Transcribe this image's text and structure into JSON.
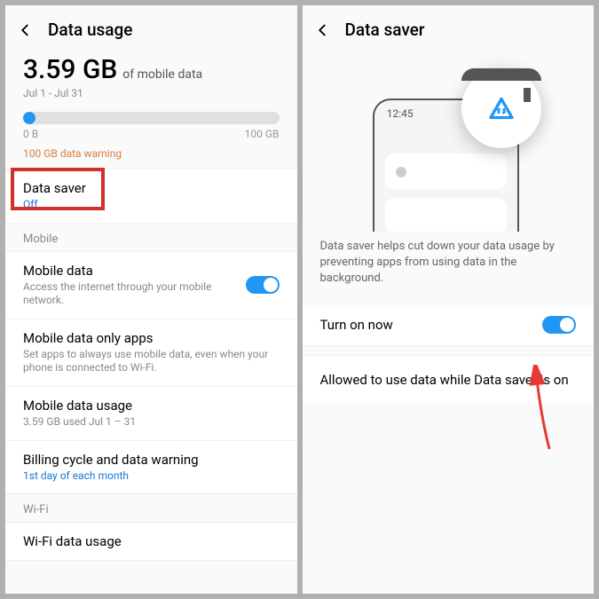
{
  "left": {
    "title": "Data usage",
    "amount": "3.59 GB",
    "amount_unit": "of mobile data",
    "date_range": "Jul 1 - Jul 31",
    "progress_min": "0 B",
    "progress_max": "100 GB",
    "warning": "100 GB data warning",
    "data_saver": {
      "title": "Data saver",
      "status": "Off"
    },
    "section_mobile": "Mobile",
    "mobile_data": {
      "title": "Mobile data",
      "sub": "Access the internet through your mobile network."
    },
    "only_apps": {
      "title": "Mobile data only apps",
      "sub": "Set apps to always use mobile data, even when your phone is connected to Wi-Fi."
    },
    "usage_item": {
      "title": "Mobile data usage",
      "sub": "3.59 GB used Jul 1 – 31"
    },
    "billing": {
      "title": "Billing cycle and data warning",
      "sub": "1st day of each month"
    },
    "section_wifi": "Wi-Fi",
    "wifi_usage": {
      "title": "Wi-Fi data usage"
    }
  },
  "right": {
    "title": "Data saver",
    "phone_time": "12:45",
    "description": "Data saver helps cut down your data usage by preventing apps from using data in the background.",
    "turn_on": "Turn on now",
    "allowed": "Allowed to use data while Data saver is on"
  }
}
